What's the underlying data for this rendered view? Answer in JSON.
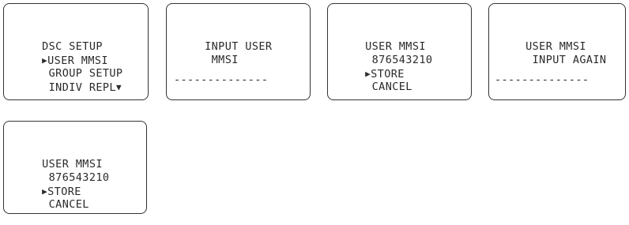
{
  "screens": [
    {
      "lines": [
        {
          "marker": "",
          "text": "DSC SETUP"
        },
        {
          "marker": "▶",
          "text": "USER MMSI"
        },
        {
          "marker": " ",
          "text": "GROUP SETUP"
        },
        {
          "marker": " ",
          "text": "INDIV REPL",
          "suffix": "▼"
        }
      ],
      "entry_line": ""
    },
    {
      "lines": [
        {
          "marker": "",
          "text": "INPUT USER"
        },
        {
          "marker": " ",
          "text": "MMSI"
        }
      ],
      "entry_line": "--------------"
    },
    {
      "lines": [
        {
          "marker": "",
          "text": "USER MMSI"
        },
        {
          "marker": " ",
          "text": "876543210"
        },
        {
          "marker": "▶",
          "text": "STORE"
        },
        {
          "marker": " ",
          "text": "CANCEL"
        }
      ],
      "entry_line": ""
    },
    {
      "lines": [
        {
          "marker": "",
          "text": "USER MMSI"
        },
        {
          "marker": " ",
          "text": "INPUT AGAIN"
        }
      ],
      "entry_line": "--------------"
    },
    {
      "lines": [
        {
          "marker": "",
          "text": "USER MMSI"
        },
        {
          "marker": " ",
          "text": "876543210"
        },
        {
          "marker": "▶",
          "text": "STORE"
        },
        {
          "marker": " ",
          "text": "CANCEL"
        }
      ],
      "entry_line": ""
    }
  ]
}
